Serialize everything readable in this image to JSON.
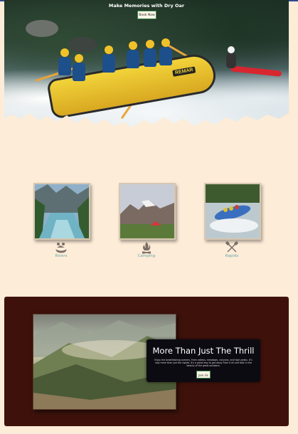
{
  "hero": {
    "title": "Make Memories with Dry Oar",
    "button_label": "Book Now",
    "raft_brand": "REMAR"
  },
  "activities": [
    {
      "label": "Rivers",
      "icon": "boat-icon"
    },
    {
      "label": "Camping",
      "icon": "campfire-icon"
    },
    {
      "label": "Rapids",
      "icon": "crossed-paddles-icon"
    }
  ],
  "feature": {
    "heading": "More Than Just The Thrill",
    "body": "Enjoy the breathtaking scenery. From valleys, meadows, canyons, and high peaks. It's way more than just the rapids. It's a great way to get away from it all and take in the beauty of the great outdoors.",
    "button_label": "Join Us"
  },
  "colors": {
    "page_background": "#fdecd8",
    "dark_section": "#3e120b",
    "accent_teal": "#6aa6a8",
    "button_border": "#3a8a4d",
    "top_bar": "#2e4a8c"
  }
}
